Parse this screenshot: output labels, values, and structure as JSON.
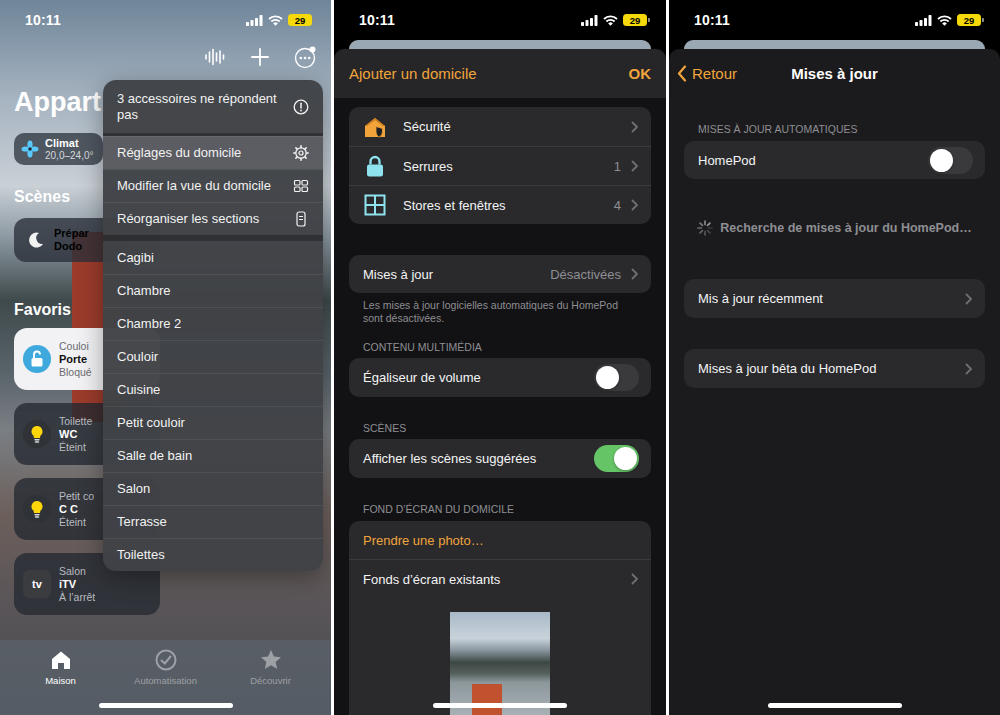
{
  "home": {
    "status_bar": {
      "time": "10:11",
      "battery": "29"
    },
    "title": "Appart",
    "climate": {
      "label": "Climat",
      "range": "20,0–24,0°"
    },
    "scenes_header": "Scènes",
    "scene": {
      "title": "Prépar",
      "subtitle": "Dodo"
    },
    "favorites_header": "Favoris",
    "favorites": [
      {
        "room": "Couloi",
        "name": "Porte",
        "status": "Bloqué",
        "active": true,
        "kind": "lock"
      },
      {
        "room": "Toilette",
        "name": "WC",
        "status": "Éteint",
        "active": false,
        "kind": "light"
      },
      {
        "room": "Petit co",
        "name": "C C",
        "status": "Éteint",
        "active": false,
        "kind": "light"
      },
      {
        "room": "Salon",
        "name": "iTV",
        "status": "À l’arrêt",
        "active": false,
        "kind": "tv",
        "badge": "tv"
      }
    ],
    "menu": {
      "items": [
        {
          "label": "3 accessoires ne répondent pas",
          "kind": "alert",
          "selected": false
        },
        {
          "label": "Réglages du domicile",
          "kind": "gear",
          "selected": true
        },
        {
          "label": "Modifier la vue du domicile",
          "kind": "grid",
          "selected": false
        },
        {
          "label": "Réorganiser les sections",
          "kind": "reorder",
          "selected": false
        }
      ],
      "rooms": [
        "Cagibi",
        "Chambre",
        "Chambre 2",
        "Couloir",
        "Cuisine",
        "Petit couloir",
        "Salle de bain",
        "Salon",
        "Terrasse",
        "Toilettes"
      ]
    },
    "tab_bar": [
      {
        "label": "Maison",
        "kind": "house",
        "selected": true
      },
      {
        "label": "Automatisation",
        "kind": "clock",
        "selected": false
      },
      {
        "label": "Découvrir",
        "kind": "star",
        "selected": false
      }
    ]
  },
  "home_settings": {
    "status_bar": {
      "time": "10:11",
      "battery": "29"
    },
    "header": {
      "title": "Ajouter un domicile",
      "action": "OK"
    },
    "categories": [
      {
        "label": "Sécurité",
        "kind": "security"
      },
      {
        "label": "Serrures",
        "count": "1",
        "kind": "lock"
      },
      {
        "label": "Stores et fenêtres",
        "count": "4",
        "kind": "blinds"
      }
    ],
    "updates_row": {
      "label": "Mises à jour",
      "value": "Désactivées"
    },
    "updates_note": "Les mises à jour logicielles automatiques du HomePod sont désactivées.",
    "media": {
      "header": "CONTENU MULTIMÉDIA",
      "toggle": {
        "label": "Égaliseur de volume",
        "on": false
      }
    },
    "scenes": {
      "header": "SCÈNES",
      "toggle": {
        "label": "Afficher les scènes suggérées",
        "on": true
      }
    },
    "wallpaper": {
      "header": "FOND D’ÉCRAN DU DOMICILE",
      "take_photo": "Prendre une photo…",
      "existing": "Fonds d’écran existants"
    }
  },
  "updates": {
    "status_bar": {
      "time": "10:11",
      "battery": "29"
    },
    "nav": {
      "back": "Retour",
      "title": "Mises à jour"
    },
    "auto_header": "MISES À JOUR AUTOMATIQUES",
    "homepod": {
      "label": "HomePod",
      "on": false
    },
    "searching": "Recherche de mises à jour du HomePod…",
    "links": [
      "Mis à jour récemment",
      "Mises à jour bêta du HomePod"
    ]
  }
}
